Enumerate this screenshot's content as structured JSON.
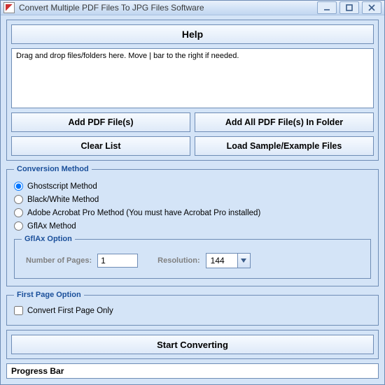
{
  "window": {
    "title": "Convert Multiple PDF Files To JPG Files Software"
  },
  "help_label": "Help",
  "drop_hint": "Drag and drop files/folders here. Move | bar to the right if needed.",
  "buttons": {
    "add_pdf": "Add PDF File(s)",
    "add_all": "Add All PDF File(s) In Folder",
    "clear": "Clear List",
    "load_sample": "Load Sample/Example Files",
    "start": "Start Converting"
  },
  "conversion": {
    "legend": "Conversion Method",
    "ghostscript": "Ghostscript Method",
    "bw": "Black/White Method",
    "acrobat": "Adobe Acrobat Pro Method (You must have Acrobat Pro installed)",
    "gflax": "GflAx Method",
    "gflax_option": {
      "legend": "GflAx Option",
      "num_pages_label": "Number of Pages:",
      "num_pages_value": "1",
      "resolution_label": "Resolution:",
      "resolution_value": "144"
    },
    "selected": "ghostscript"
  },
  "first_page": {
    "legend": "First Page Option",
    "label": "Convert First Page Only",
    "checked": false
  },
  "progress_label": "Progress Bar"
}
